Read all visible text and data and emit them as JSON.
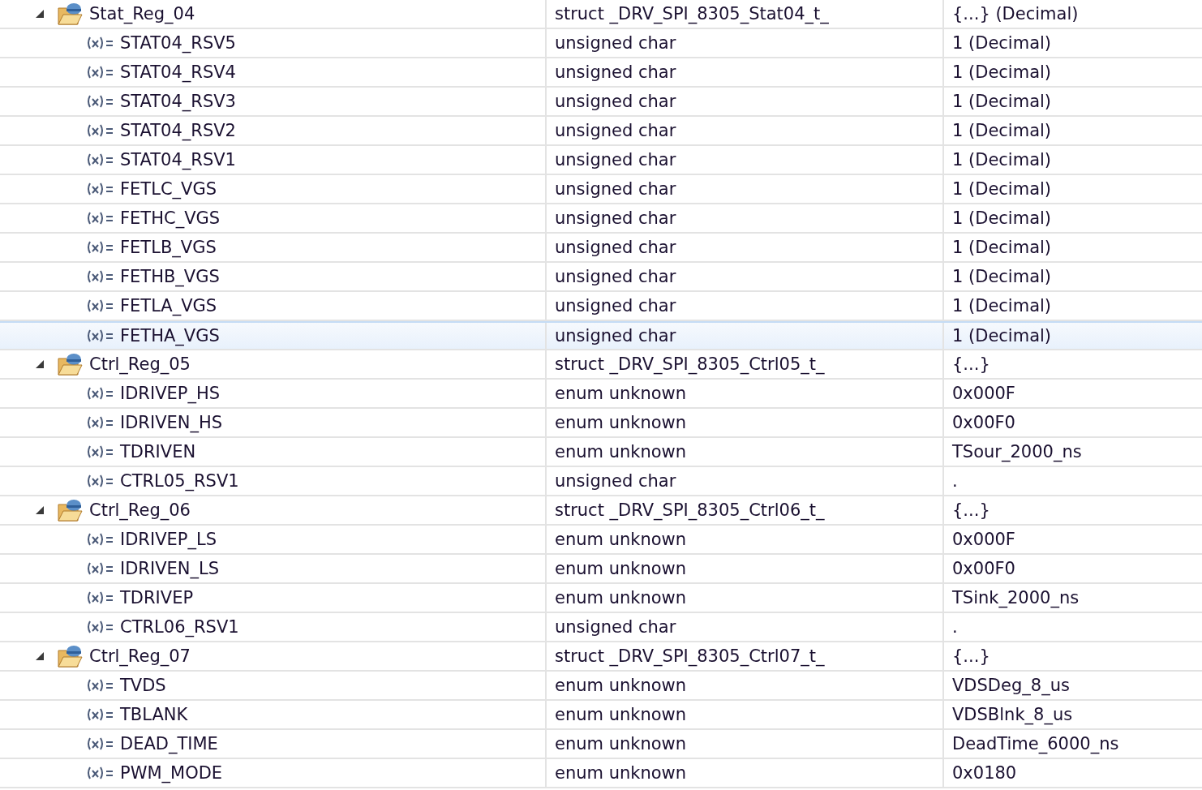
{
  "variables": [
    {
      "name": "Stat_Reg_04",
      "type": "struct _DRV_SPI_8305_Stat04_t_",
      "value": "{...} (Decimal)",
      "expanded": true,
      "selected": false,
      "children": [
        {
          "name": "STAT04_RSV5",
          "type": "unsigned char",
          "value": "1 (Decimal)",
          "selected": false
        },
        {
          "name": "STAT04_RSV4",
          "type": "unsigned char",
          "value": "1 (Decimal)",
          "selected": false
        },
        {
          "name": "STAT04_RSV3",
          "type": "unsigned char",
          "value": "1 (Decimal)",
          "selected": false
        },
        {
          "name": "STAT04_RSV2",
          "type": "unsigned char",
          "value": "1 (Decimal)",
          "selected": false
        },
        {
          "name": "STAT04_RSV1",
          "type": "unsigned char",
          "value": "1 (Decimal)",
          "selected": false
        },
        {
          "name": "FETLC_VGS",
          "type": "unsigned char",
          "value": "1 (Decimal)",
          "selected": false
        },
        {
          "name": "FETHC_VGS",
          "type": "unsigned char",
          "value": "1 (Decimal)",
          "selected": false
        },
        {
          "name": "FETLB_VGS",
          "type": "unsigned char",
          "value": "1 (Decimal)",
          "selected": false
        },
        {
          "name": "FETHB_VGS",
          "type": "unsigned char",
          "value": "1 (Decimal)",
          "selected": false
        },
        {
          "name": "FETLA_VGS",
          "type": "unsigned char",
          "value": "1 (Decimal)",
          "selected": false
        },
        {
          "name": "FETHA_VGS",
          "type": "unsigned char",
          "value": "1 (Decimal)",
          "selected": true
        }
      ]
    },
    {
      "name": "Ctrl_Reg_05",
      "type": "struct _DRV_SPI_8305_Ctrl05_t_",
      "value": "{...}",
      "expanded": true,
      "selected": false,
      "children": [
        {
          "name": "IDRIVEP_HS",
          "type": "enum unknown",
          "value": "0x000F",
          "selected": false
        },
        {
          "name": "IDRIVEN_HS",
          "type": "enum unknown",
          "value": "0x00F0",
          "selected": false
        },
        {
          "name": "TDRIVEN",
          "type": "enum unknown",
          "value": "TSour_2000_ns",
          "selected": false
        },
        {
          "name": "CTRL05_RSV1",
          "type": "unsigned char",
          "value": ".",
          "selected": false
        }
      ]
    },
    {
      "name": "Ctrl_Reg_06",
      "type": "struct _DRV_SPI_8305_Ctrl06_t_",
      "value": "{...}",
      "expanded": true,
      "selected": false,
      "children": [
        {
          "name": "IDRIVEP_LS",
          "type": "enum unknown",
          "value": "0x000F",
          "selected": false
        },
        {
          "name": "IDRIVEN_LS",
          "type": "enum unknown",
          "value": "0x00F0",
          "selected": false
        },
        {
          "name": "TDRIVEP",
          "type": "enum unknown",
          "value": "TSink_2000_ns",
          "selected": false
        },
        {
          "name": "CTRL06_RSV1",
          "type": "unsigned char",
          "value": ".",
          "selected": false
        }
      ]
    },
    {
      "name": "Ctrl_Reg_07",
      "type": "struct _DRV_SPI_8305_Ctrl07_t_",
      "value": "{...}",
      "expanded": true,
      "selected": false,
      "children": [
        {
          "name": "TVDS",
          "type": "enum unknown",
          "value": "VDSDeg_8_us",
          "selected": false
        },
        {
          "name": "TBLANK",
          "type": "enum unknown",
          "value": "VDSBlnk_8_us",
          "selected": false
        },
        {
          "name": "DEAD_TIME",
          "type": "enum unknown",
          "value": "DeadTime_6000_ns",
          "selected": false
        },
        {
          "name": "PWM_MODE",
          "type": "enum unknown",
          "value": "0x0180",
          "selected": false
        }
      ]
    }
  ]
}
